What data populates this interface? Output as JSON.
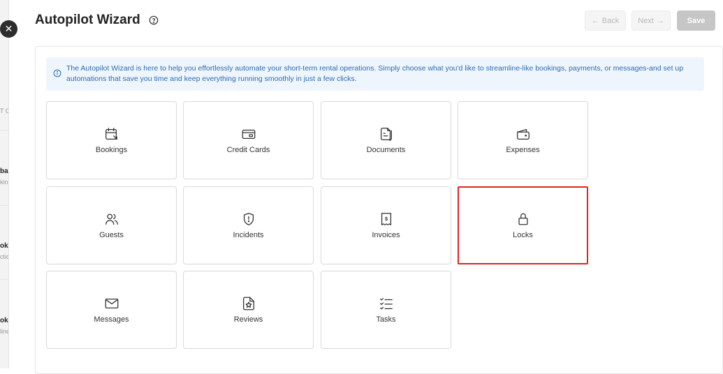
{
  "background": {
    "fragments": [
      "T C",
      "ba",
      "kin",
      "ok",
      "ctio",
      "ok",
      "line"
    ]
  },
  "header": {
    "title": "Autopilot Wizard",
    "back_label": "Back",
    "next_label": "Next",
    "save_label": "Save"
  },
  "info": {
    "text": "The Autopilot Wizard is here to help you effortlessly automate your short-term rental operations. Simply choose what you'd like to streamline-like bookings, payments, or messages-and set up automations that save you time and keep everything running smoothly in just a few clicks."
  },
  "tiles": [
    {
      "label": "Bookings",
      "icon": "calendar-icon"
    },
    {
      "label": "Credit Cards",
      "icon": "credit-card-icon"
    },
    {
      "label": "Documents",
      "icon": "documents-icon"
    },
    {
      "label": "Expenses",
      "icon": "wallet-icon"
    },
    {
      "label": "Guests",
      "icon": "users-icon"
    },
    {
      "label": "Incidents",
      "icon": "shield-alert-icon"
    },
    {
      "label": "Invoices",
      "icon": "receipt-icon"
    },
    {
      "label": "Locks",
      "icon": "lock-icon",
      "selected": true
    },
    {
      "label": "Messages",
      "icon": "mail-icon"
    },
    {
      "label": "Reviews",
      "icon": "review-star-icon"
    },
    {
      "label": "Tasks",
      "icon": "checklist-icon"
    }
  ],
  "colors": {
    "selected_border": "#e02424",
    "info_background": "#eef5fd",
    "info_text": "#2b6cb0",
    "save_button": "#c6c6c6"
  }
}
